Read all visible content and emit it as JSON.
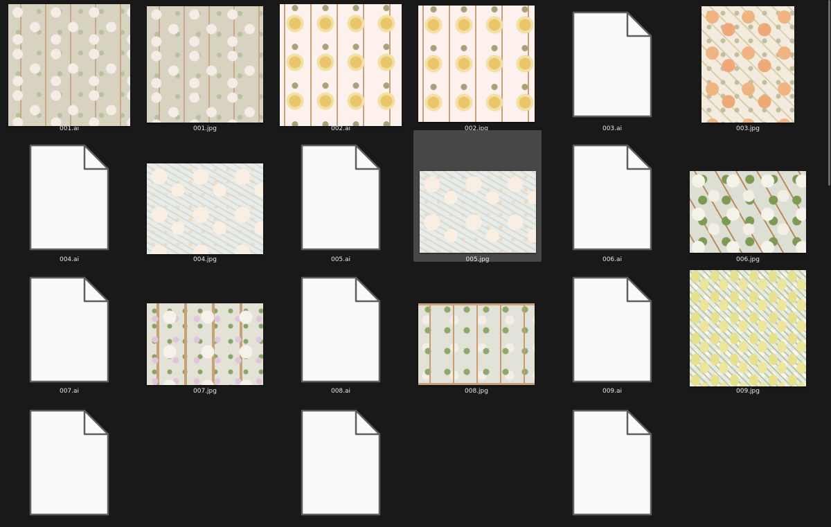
{
  "files": [
    {
      "label": "001.ai",
      "kind": "thumb",
      "pattern": "trellis-grey"
    },
    {
      "label": "001.jpg",
      "kind": "thumb",
      "pattern": "trellis-grey"
    },
    {
      "label": "002.ai",
      "kind": "thumb",
      "pattern": "columns-pink"
    },
    {
      "label": "002.jpg",
      "kind": "thumb",
      "pattern": "columns-pink"
    },
    {
      "label": "003.ai",
      "kind": "document"
    },
    {
      "label": "003.jpg",
      "kind": "thumb",
      "pattern": "nouveau-peach"
    },
    {
      "label": "004.ai",
      "kind": "document"
    },
    {
      "label": "004.jpg",
      "kind": "thumb",
      "pattern": "pale-floral"
    },
    {
      "label": "005.ai",
      "kind": "document"
    },
    {
      "label": "005.jpg",
      "kind": "thumb",
      "pattern": "pale-floral",
      "selected": true
    },
    {
      "label": "006.ai",
      "kind": "document"
    },
    {
      "label": "006.jpg",
      "kind": "thumb",
      "pattern": "green-rose"
    },
    {
      "label": "007.ai",
      "kind": "document"
    },
    {
      "label": "007.jpg",
      "kind": "thumb",
      "pattern": "lattice-floral"
    },
    {
      "label": "008.ai",
      "kind": "document"
    },
    {
      "label": "008.jpg",
      "kind": "thumb",
      "pattern": "arch-border"
    },
    {
      "label": "009.ai",
      "kind": "document"
    },
    {
      "label": "009.jpg",
      "kind": "thumb",
      "pattern": "lemon"
    },
    {
      "label": "",
      "kind": "document"
    },
    {
      "label": "",
      "kind": "empty"
    },
    {
      "label": "",
      "kind": "document"
    },
    {
      "label": "",
      "kind": "empty"
    },
    {
      "label": "",
      "kind": "document"
    },
    {
      "label": "",
      "kind": "empty"
    }
  ],
  "colors": {
    "background": "#191919",
    "selection": "#474747",
    "label_text": "#e6e6e6",
    "document_fill": "#fafafa",
    "document_outline": "#5e5e5e"
  }
}
